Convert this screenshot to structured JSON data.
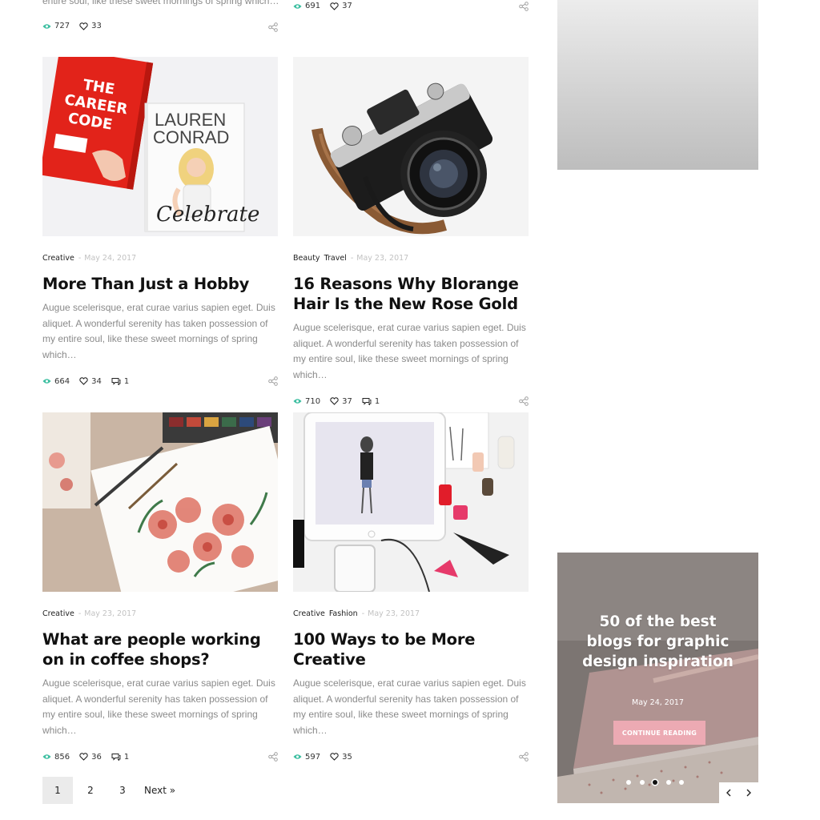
{
  "colors": {
    "accent": "#3dbfa1",
    "button": "#ecaab3",
    "text_muted": "#8a8a8a",
    "date_muted": "#c2c2c2",
    "title": "#111111"
  },
  "top_row": {
    "left": {
      "excerpt": "entire soul, like these sweet mornings of spring which…",
      "views": "727",
      "likes": "33"
    },
    "right": {
      "views": "691",
      "likes": "37"
    }
  },
  "posts": [
    {
      "categories": [
        "Creative"
      ],
      "date": "May 24, 2017",
      "title": "More Than Just a Hobby",
      "excerpt": "Augue scelerisque, erat curae varius sapien eget. Duis aliquet. A wonderful serenity has taken possession of my entire soul, like these sweet mornings of spring which…",
      "views": "664",
      "likes": "34",
      "comments": "1",
      "image_text": {
        "book1": "THE CAREER CODE",
        "book2_top": "LAUREN CONRAD",
        "book2_script": "Celebrate"
      }
    },
    {
      "categories": [
        "Beauty",
        "Travel"
      ],
      "date": "May 23, 2017",
      "title": "16 Reasons Why Blorange Hair Is the New Rose Gold",
      "excerpt": "Augue scelerisque, erat curae varius sapien eget. Duis aliquet. A wonderful serenity has taken possession of my entire soul, like these sweet mornings of spring which…",
      "views": "710",
      "likes": "37",
      "comments": "1"
    },
    {
      "categories": [
        "Creative"
      ],
      "date": "May 23, 2017",
      "title": "What are people working on in coffee shops?",
      "excerpt": "Augue scelerisque, erat curae varius sapien eget. Duis aliquet. A wonderful serenity has taken possession of my entire soul, like these sweet mornings of spring which…",
      "views": "856",
      "likes": "36",
      "comments": "1"
    },
    {
      "categories": [
        "Creative",
        "Fashion"
      ],
      "date": "May 23, 2017",
      "title": "100 Ways to be More Creative",
      "excerpt": "Augue scelerisque, erat curae varius sapien eget. Duis aliquet. A wonderful serenity has taken possession of my entire soul, like these sweet mornings of spring which…",
      "views": "597",
      "likes": "35"
    }
  ],
  "pagination": {
    "pages": [
      "1",
      "2",
      "3"
    ],
    "current": "1",
    "next": "Next »"
  },
  "slider": {
    "title": "50 of the best blogs for graphic design inspiration",
    "date": "May 24, 2017",
    "button": "CONTINUE READING",
    "slide_count": 5,
    "active_slide": 3
  }
}
